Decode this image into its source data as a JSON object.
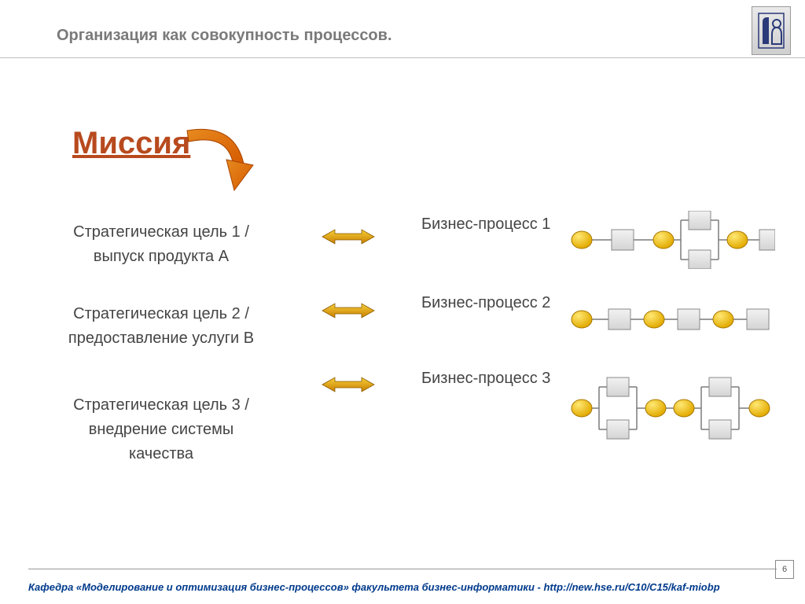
{
  "header": {
    "title": "Организация как совокупность процессов."
  },
  "mission": "Миссия",
  "goals": [
    {
      "line1": "Стратегическая цель 1 /",
      "line2": "выпуск продукта А"
    },
    {
      "line1": "Стратегическая цель 2 /",
      "line2": "предоставление услуги В"
    },
    {
      "line1": "Стратегическая цель 3 /",
      "line2": "внедрение системы качества"
    }
  ],
  "processes": [
    "Бизнес-процесс 1",
    "Бизнес-процесс 2",
    "Бизнес-процесс 3"
  ],
  "footer": {
    "text": "Кафедра «Моделирование и оптимизация бизнес-процессов» факультета бизнес-информатики - http://new.hse.ru/C10/C15/kaf-miobp",
    "page": "6"
  }
}
